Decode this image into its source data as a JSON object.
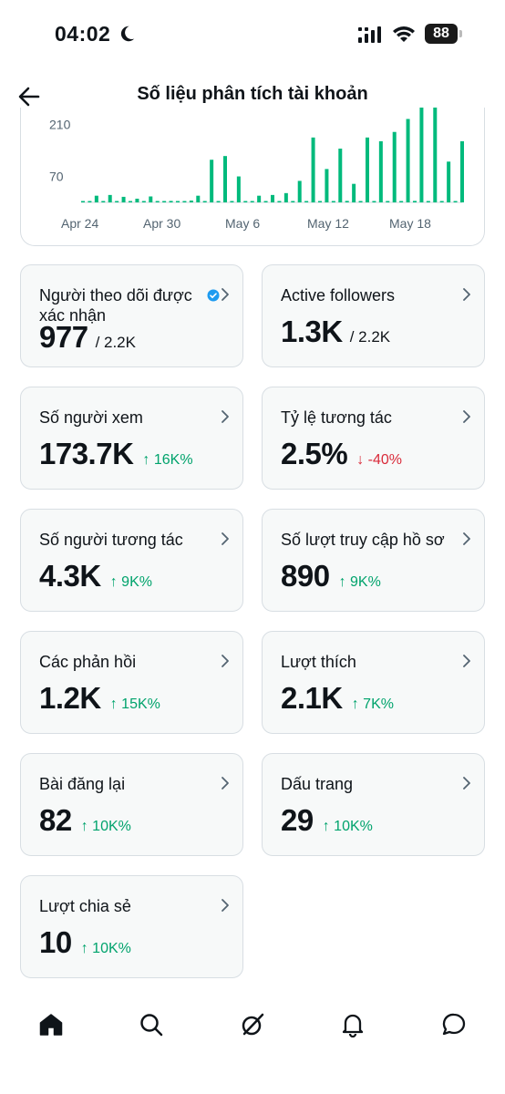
{
  "status_bar": {
    "time": "04:02",
    "battery": "88"
  },
  "header": {
    "title": "Số liệu phân tích tài khoản"
  },
  "chart_data": {
    "type": "bar",
    "y_ticks": [
      "210",
      "70"
    ],
    "x_ticks": [
      "Apr 24",
      "Apr 30",
      "May 6",
      "May 12",
      "May 18"
    ],
    "values": [
      2,
      3,
      18,
      1,
      20,
      2,
      15,
      3,
      10,
      1,
      16,
      1,
      2,
      4,
      1,
      3,
      5,
      18,
      2,
      115,
      3,
      125,
      2,
      70,
      2,
      3,
      18,
      2,
      20,
      3,
      25,
      2,
      58,
      3,
      175,
      2,
      90,
      2,
      145,
      4,
      50,
      3,
      175,
      2,
      165,
      3,
      190,
      2,
      225,
      4,
      260,
      2,
      285,
      3,
      110,
      2,
      165
    ],
    "ylim": [
      0,
      300
    ],
    "color": "#00ba7c"
  },
  "cards": [
    {
      "label": "Người theo dõi được xác nhận",
      "value": "977",
      "sub": "/ 2.2K",
      "verified": true
    },
    {
      "label": "Active followers",
      "value": "1.3K",
      "sub": "/ 2.2K"
    },
    {
      "label": "Số người xem",
      "value": "173.7K",
      "change": "↑ 16K%",
      "dir": "up"
    },
    {
      "label": "Tỷ lệ tương tác",
      "value": "2.5%",
      "change": "↓ -40%",
      "dir": "down"
    },
    {
      "label": "Số người tương tác",
      "value": "4.3K",
      "change": "↑ 9K%",
      "dir": "up"
    },
    {
      "label": "Số lượt truy cập hồ sơ",
      "value": "890",
      "change": "↑ 9K%",
      "dir": "up"
    },
    {
      "label": "Các phản hồi",
      "value": "1.2K",
      "change": "↑ 15K%",
      "dir": "up"
    },
    {
      "label": "Lượt thích",
      "value": "2.1K",
      "change": "↑ 7K%",
      "dir": "up"
    },
    {
      "label": "Bài đăng lại",
      "value": "82",
      "change": "↑ 10K%",
      "dir": "up"
    },
    {
      "label": "Dấu trang",
      "value": "29",
      "change": "↑ 10K%",
      "dir": "up"
    },
    {
      "label": "Lượt chia sẻ",
      "value": "10",
      "change": "↑ 10K%",
      "dir": "up"
    }
  ],
  "nav": [
    "home-icon",
    "search-icon",
    "grok-icon",
    "bell-icon",
    "messages-icon"
  ],
  "colors": {
    "accent_up": "#00a36c",
    "accent_down": "#d92b3a",
    "verified": "#1d9bf0"
  }
}
